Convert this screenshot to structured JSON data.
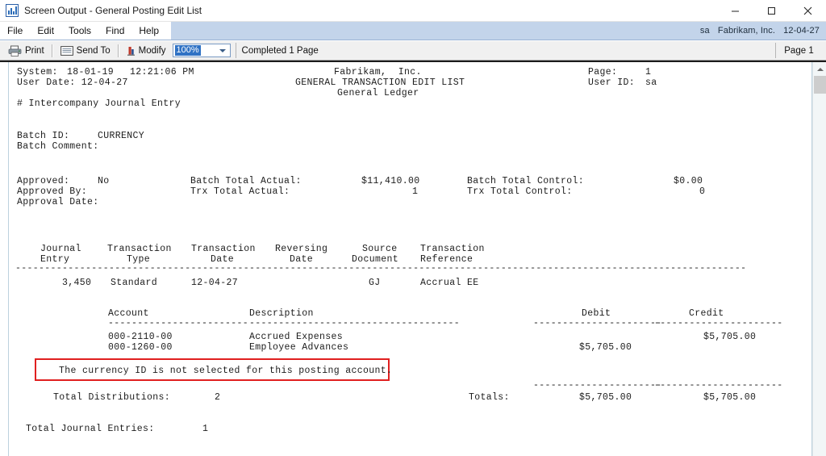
{
  "window": {
    "title": "Screen Output - General Posting Edit List",
    "icon": "report-chart-icon",
    "minimize_label": "Minimize",
    "maximize_label": "Maximize",
    "close_label": "Close"
  },
  "menubar": {
    "items": [
      {
        "label": "File"
      },
      {
        "label": "Edit"
      },
      {
        "label": "Tools"
      },
      {
        "label": "Find"
      },
      {
        "label": "Help"
      }
    ],
    "user": "sa",
    "company": "Fabrikam, Inc.",
    "date": "12-04-27"
  },
  "toolbar": {
    "print_label": "Print",
    "send_to_label": "Send To",
    "modify_label": "Modify",
    "zoom_value": "100%",
    "status_text": "Completed 1 Page",
    "page_text": "Page 1"
  },
  "report": {
    "header": {
      "system_label": "System:",
      "system_date": "18-01-19",
      "system_time": "12:21:06 PM",
      "user_date_label": "User Date: 12-04-27",
      "company": "Fabrikam,  Inc.",
      "report_title": "GENERAL TRANSACTION EDIT LIST",
      "module": "General Ledger",
      "page_label": "Page:",
      "page_value": "1",
      "user_id_label": "User ID:",
      "user_id_value": "sa"
    },
    "note": "# Intercompany Journal Entry",
    "batch": {
      "batch_id_label": "Batch ID:",
      "batch_id_value": "CURRENCY",
      "batch_comment_label": "Batch Comment:",
      "approved_label": "Approved:",
      "approved_value": "No",
      "approved_by_label": "Approved By:",
      "approval_date_label": "Approval Date:",
      "batch_total_actual_label": "Batch Total Actual:",
      "batch_total_actual_value": "$11,410.00",
      "trx_total_actual_label": "Trx Total Actual:",
      "trx_total_actual_value": "1",
      "batch_total_control_label": "Batch Total Control:",
      "batch_total_control_value": "$0.00",
      "trx_total_control_label": "Trx Total Control:",
      "trx_total_control_value": "0"
    },
    "journal_columns": {
      "line1": [
        "Journal",
        "Transaction",
        "Transaction",
        "Reversing",
        "Source",
        "Transaction"
      ],
      "line2": [
        "Entry",
        "Type",
        "Date",
        "Date",
        "Document",
        "Reference"
      ]
    },
    "journal_row": {
      "entry": "3,450",
      "type": "Standard",
      "date": "12-04-27",
      "reversing_date": "",
      "source_document": "GJ",
      "reference": "Accrual EE"
    },
    "dist_columns": {
      "account": "Account",
      "description": "Description",
      "debit": "Debit",
      "credit": "Credit"
    },
    "distributions": [
      {
        "account": "000-2110-00",
        "description": "Accrued Expenses",
        "debit": "",
        "credit": "$5,705.00"
      },
      {
        "account": "000-1260-00",
        "description": "Employee Advances",
        "debit": "$5,705.00",
        "credit": ""
      }
    ],
    "error_message": "The currency ID is not selected for this posting account.",
    "error_color": "#e02020",
    "total_distributions_label": "Total Distributions:",
    "total_distributions_value": "2",
    "totals_label": "Totals:",
    "totals_debit": "$5,705.00",
    "totals_credit": "$5,705.00",
    "total_journal_entries_label": "Total Journal Entries:",
    "total_journal_entries_value": "1",
    "dashes_long": "-----------------------------------------------------------------------------------------------------------------------------",
    "dashes_account": "------------------------",
    "dashes_description": "------------------------------------",
    "dashes_amount": "----------------------"
  }
}
